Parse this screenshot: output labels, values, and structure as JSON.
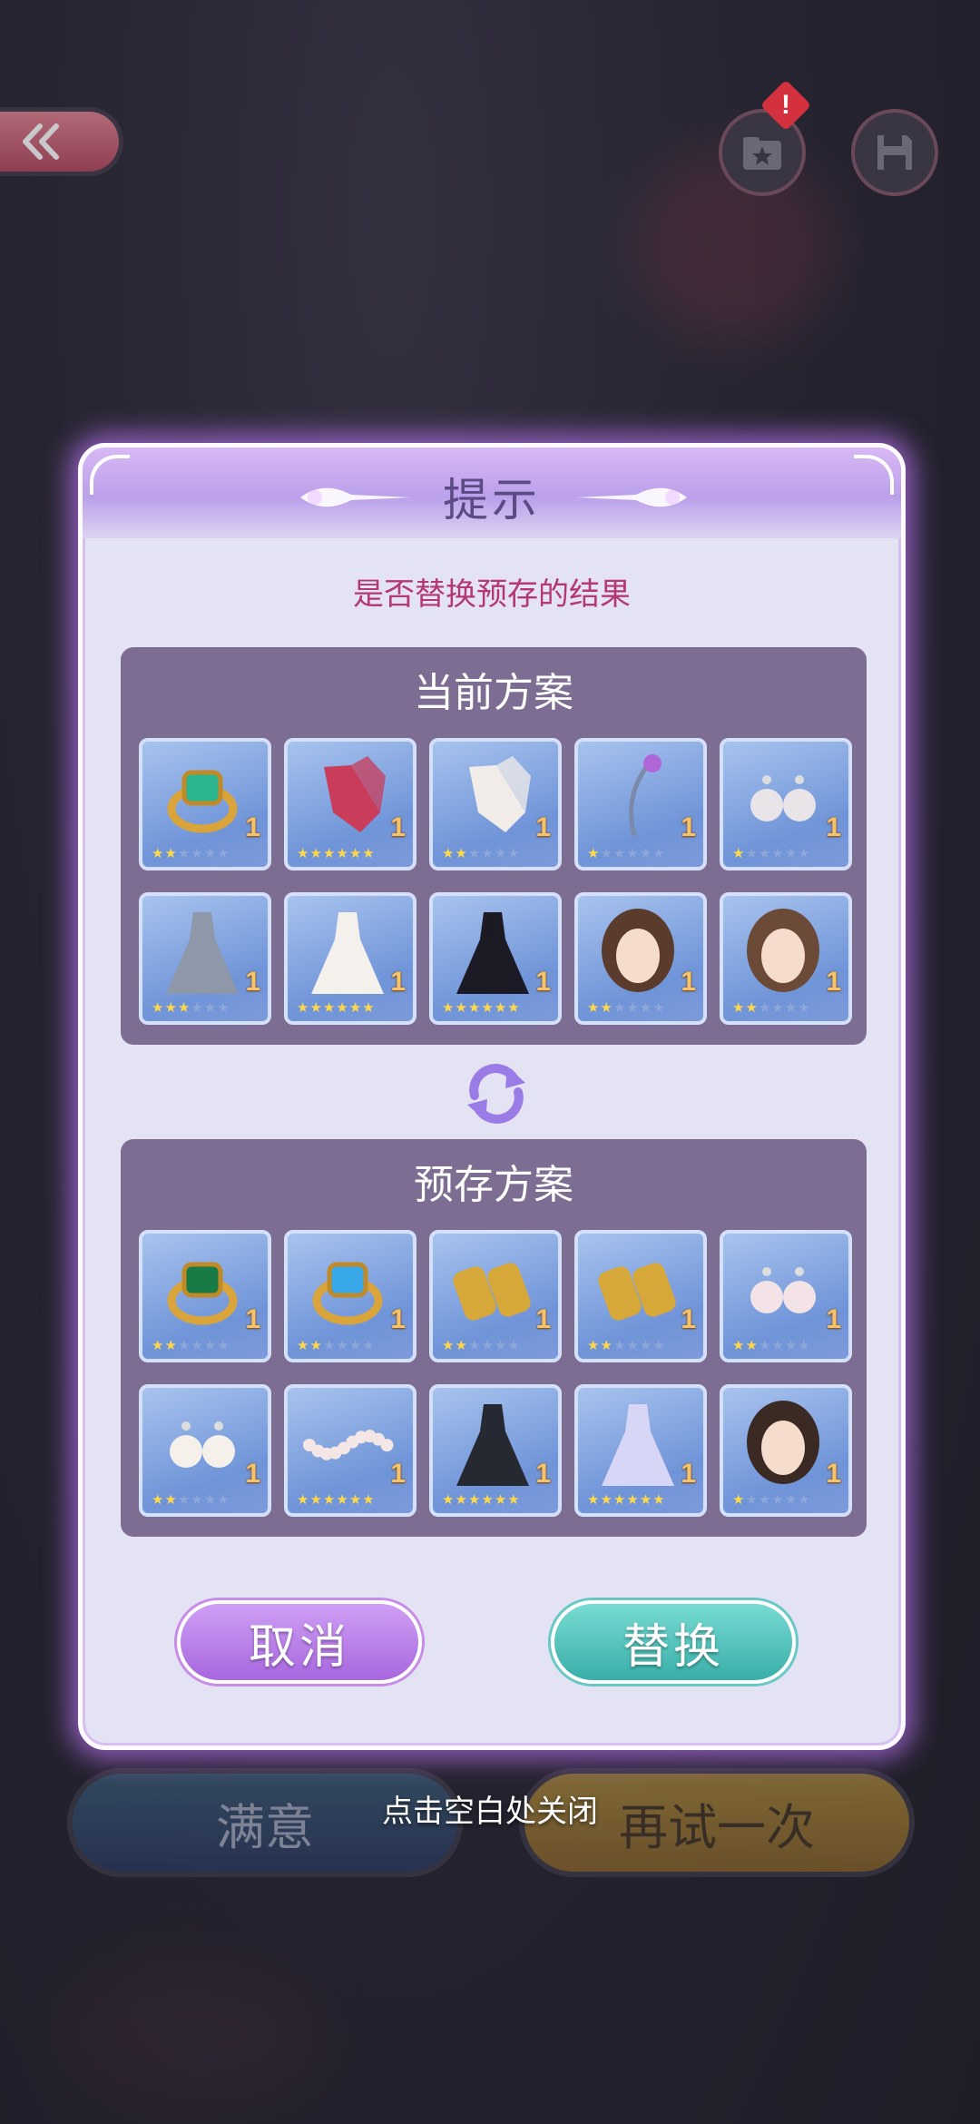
{
  "background": {
    "back_icon": "double-chevron-left-icon",
    "outfit_folder_icon": "star-folder-icon",
    "save_icon": "floppy-disk-icon",
    "alert_badge": "!",
    "satisfied_label": "满意",
    "retry_label": "再试一次"
  },
  "close_hint": "点击空白处关闭",
  "dialog": {
    "title": "提示",
    "subtitle": "是否替换预存的结果",
    "current": {
      "title": "当前方案",
      "items": [
        {
          "name": "emerald-ring",
          "qty": "1",
          "stars": 2
        },
        {
          "name": "red-lace-gloves",
          "qty": "1",
          "stars": 6
        },
        {
          "name": "white-floral-gloves",
          "qty": "1",
          "stars": 2
        },
        {
          "name": "feather-hairpin",
          "qty": "1",
          "stars": 1
        },
        {
          "name": "pearl-earrings",
          "qty": "1",
          "stars": 1
        },
        {
          "name": "grey-victorian-dress",
          "qty": "1",
          "stars": 3
        },
        {
          "name": "white-wedding-dress",
          "qty": "1",
          "stars": 6
        },
        {
          "name": "black-gown",
          "qty": "1",
          "stars": 6
        },
        {
          "name": "braided-brown-hair",
          "qty": "1",
          "stars": 2
        },
        {
          "name": "wavy-brown-hair",
          "qty": "1",
          "stars": 2
        }
      ]
    },
    "saved": {
      "title": "预存方案",
      "items": [
        {
          "name": "green-gem-ring",
          "qty": "1",
          "stars": 2
        },
        {
          "name": "blue-gem-ring",
          "qty": "1",
          "stars": 2
        },
        {
          "name": "gold-cuffs",
          "qty": "1",
          "stars": 2
        },
        {
          "name": "gold-cuffs-2",
          "qty": "1",
          "stars": 2
        },
        {
          "name": "drop-pearl-earrings",
          "qty": "1",
          "stars": 2
        },
        {
          "name": "pearl-gold-earrings",
          "qty": "1",
          "stars": 2
        },
        {
          "name": "pearl-bracelet",
          "qty": "1",
          "stars": 6
        },
        {
          "name": "black-coat-outfit",
          "qty": "1",
          "stars": 6
        },
        {
          "name": "lavender-gown",
          "qty": "1",
          "stars": 6
        },
        {
          "name": "long-dark-hair",
          "qty": "1",
          "stars": 1
        }
      ]
    },
    "swap_icon": "swap-arrows-icon",
    "cancel_label": "取消",
    "replace_label": "替换"
  },
  "colors": {
    "accent_purple": "#a867de",
    "accent_teal": "#3aaea9",
    "subtitle_pink": "#b43874",
    "panel_bg": "#7d6d92"
  }
}
